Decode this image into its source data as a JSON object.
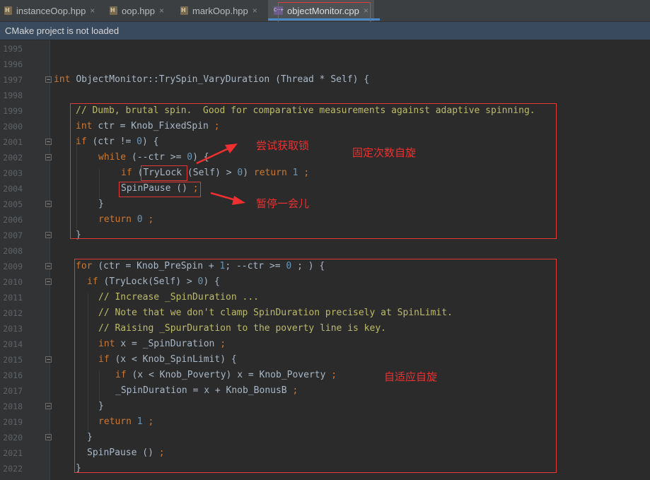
{
  "tabs": [
    {
      "label": "instanceOop.hpp",
      "icon": "h-file-icon",
      "active": false
    },
    {
      "label": "oop.hpp",
      "icon": "h-file-icon",
      "active": false
    },
    {
      "label": "markOop.hpp",
      "icon": "h-file-icon",
      "active": false
    },
    {
      "label": "objectMonitor.cpp",
      "icon": "cpp-file-icon",
      "active": true
    }
  ],
  "close_glyph": "×",
  "notice": "CMake project is not loaded",
  "line_numbers": [
    "1995",
    "1996",
    "1997",
    "1998",
    "1999",
    "2000",
    "2001",
    "2002",
    "2003",
    "2004",
    "2005",
    "2006",
    "2007",
    "2008",
    "2009",
    "2010",
    "2011",
    "2012",
    "2013",
    "2014",
    "2015",
    "2016",
    "2017",
    "2018",
    "2019",
    "2020",
    "2021",
    "2022"
  ],
  "code": {
    "l1997": {
      "kw": "int",
      "sig": "ObjectMonitor::TrySpin_VaryDuration (Thread * Self) {"
    },
    "l1999": "// Dumb, brutal spin.  Good for comparative measurements against adaptive spinning.",
    "l2000": {
      "kw": "int",
      "a": "ctr = Knob_FixedSpin ",
      "semi": ";"
    },
    "l2001": {
      "kw": "if",
      "a": "(ctr != ",
      "n": "0",
      "b": ") {"
    },
    "l2002": {
      "kw": "while",
      "a": "(--ctr >= ",
      "n": "0",
      "b": ") {"
    },
    "l2003": {
      "kw": "if",
      "a": "(",
      "fn": "TryLock",
      "b": " (Self) > ",
      "n": "0",
      "c": ") ",
      "kw2": "return",
      "n2": "1",
      "semi": ";"
    },
    "l2004": {
      "fn": "SpinPause",
      "a": " () ",
      "semi": ";"
    },
    "l2005": "}",
    "l2006": {
      "kw": "return",
      "n": "0",
      "semi": ";"
    },
    "l2007": "}",
    "l2009": {
      "kw": "for",
      "a": "(ctr = Knob_PreSpin + ",
      "n": "1",
      "b": "; --ctr >= ",
      "n2": "0",
      "c": " ; ) {"
    },
    "l2010": {
      "kw": "if",
      "a": "(TryLock(Self) > ",
      "n": "0",
      "b": ") {"
    },
    "l2011": "// Increase _SpinDuration ...",
    "l2012": "// Note that we don't clamp SpinDuration precisely at SpinLimit.",
    "l2013": "// Raising _SpurDuration to the poverty line is key.",
    "l2014": {
      "kw": "int",
      "a": "x = _SpinDuration ",
      "semi": ";"
    },
    "l2015": {
      "kw": "if",
      "a": "(x < Knob_SpinLimit) {"
    },
    "l2016": {
      "kw": "if",
      "a": "(x < Knob_Poverty) x = Knob_Poverty ",
      "semi": ";"
    },
    "l2017": {
      "a": "_SpinDuration = x + Knob_BonusB ",
      "semi": ";"
    },
    "l2018": "}",
    "l2019": {
      "kw": "return",
      "n": "1",
      "semi": ";"
    },
    "l2020": "}",
    "l2021": {
      "a": "SpinPause () ",
      "semi": ";"
    },
    "l2022": "}"
  },
  "annotations": {
    "try_lock": "尝试获取锁",
    "fixed_spin": "固定次数自旋",
    "pause": "暂停一会儿",
    "adaptive_spin": "自适应自旋"
  }
}
